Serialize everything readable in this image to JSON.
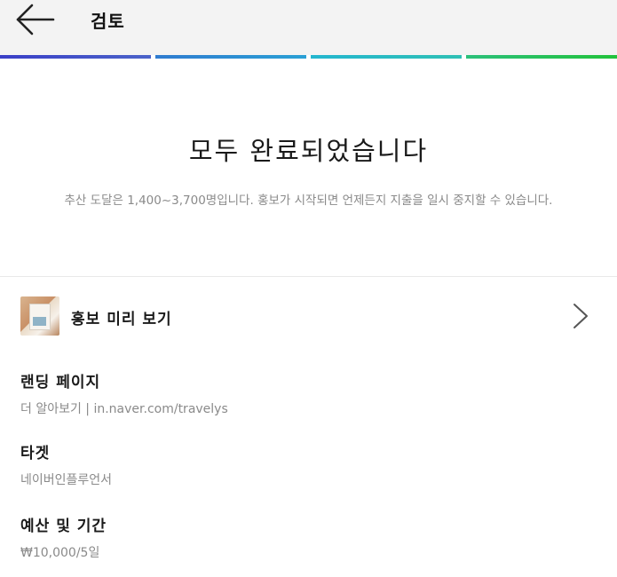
{
  "header": {
    "title": "검토",
    "back_icon": "arrow-left-icon"
  },
  "progress": {
    "steps_total": 4,
    "steps_completed": 4,
    "colors": [
      "#3a3fc7",
      "#2a9fd5",
      "#27b9c9",
      "#22c23b"
    ]
  },
  "completion": {
    "title": "모두 완료되었습니다",
    "description": "추산 도달은 1,400~3,700명입니다. 홍보가 시작되면 언제든지 지출을 일시 중지할 수 있습니다."
  },
  "preview": {
    "label": "홍보 미리 보기",
    "chevron_icon": "chevron-right-icon"
  },
  "details": {
    "landing": {
      "label": "랜딩 페이지",
      "value": "더 알아보기 | in.naver.com/travelys"
    },
    "target": {
      "label": "타겟",
      "value": "네이버인플루언서"
    },
    "budget": {
      "label": "예산 및 기간",
      "value": "₩10,000/5일"
    }
  }
}
